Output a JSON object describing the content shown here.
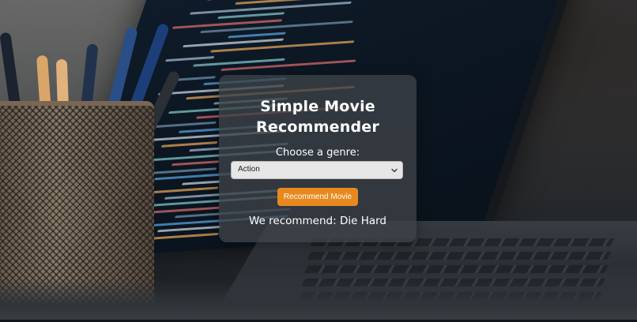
{
  "app": {
    "title": "Simple Movie Recommender"
  },
  "form": {
    "genre_label": "Choose a genre:",
    "genre_selected": "Action",
    "button_label": "Recommend Movie",
    "button_color": "#e8891f"
  },
  "result": {
    "text": "We recommend: Die Hard"
  },
  "icons": {
    "select_chevron": "chevron-down-icon"
  }
}
